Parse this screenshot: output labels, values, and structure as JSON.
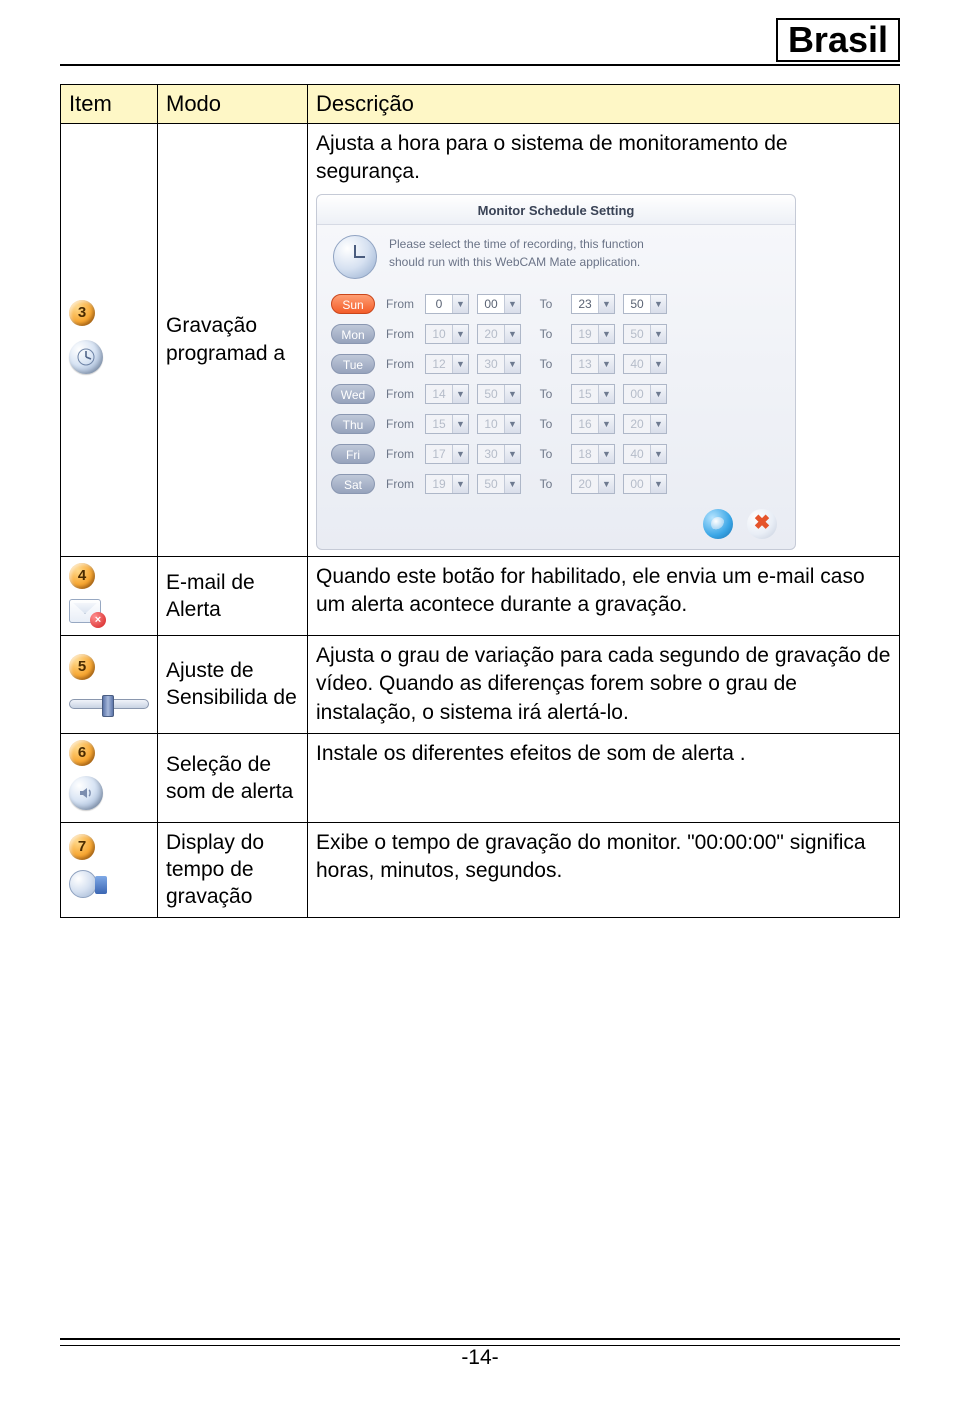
{
  "brand": "Brasil",
  "page_number": "-14-",
  "table": {
    "headers": {
      "item": "Item",
      "modo": "Modo",
      "descricao": "Descrição"
    },
    "row3": {
      "num": "3",
      "modo": "Gravação programad a",
      "desc_intro": "Ajusta a hora para o sistema de monitoramento de segurança."
    },
    "row4": {
      "num": "4",
      "modo": "E-mail de Alerta",
      "desc": "Quando este botão for habilitado, ele envia um e-mail caso um alerta acontece durante a gravação."
    },
    "row5": {
      "num": "5",
      "modo": "Ajuste de Sensibilida de",
      "desc": "Ajusta o grau de variação para cada segundo de gravação de vídeo. Quando as diferenças forem sobre o grau de instalação, o sistema irá alertá-lo."
    },
    "row6": {
      "num": "6",
      "modo": "Seleção de som de alerta",
      "desc": "Instale os diferentes efeitos de som de alerta ."
    },
    "row7": {
      "num": "7",
      "modo": "Display do tempo de gravação",
      "desc": "Exibe o tempo de gravação do monitor. \"00:00:00\" significa horas, minutos, segundos."
    }
  },
  "schedule": {
    "title": "Monitor Schedule Setting",
    "hint1": "Please select the time of recording, this function",
    "hint2": "should run with this WebCAM Mate application.",
    "from_label": "From",
    "to_label": "To",
    "days": [
      {
        "name": "Sun",
        "active": true,
        "from_h": "0",
        "from_m": "00",
        "to_h": "23",
        "to_m": "50"
      },
      {
        "name": "Mon",
        "active": false,
        "from_h": "10",
        "from_m": "20",
        "to_h": "19",
        "to_m": "50"
      },
      {
        "name": "Tue",
        "active": false,
        "from_h": "12",
        "from_m": "30",
        "to_h": "13",
        "to_m": "40"
      },
      {
        "name": "Wed",
        "active": false,
        "from_h": "14",
        "from_m": "50",
        "to_h": "15",
        "to_m": "00"
      },
      {
        "name": "Thu",
        "active": false,
        "from_h": "15",
        "from_m": "10",
        "to_h": "16",
        "to_m": "20"
      },
      {
        "name": "Fri",
        "active": false,
        "from_h": "17",
        "from_m": "30",
        "to_h": "18",
        "to_m": "40"
      },
      {
        "name": "Sat",
        "active": false,
        "from_h": "19",
        "from_m": "50",
        "to_h": "20",
        "to_m": "00"
      }
    ]
  }
}
